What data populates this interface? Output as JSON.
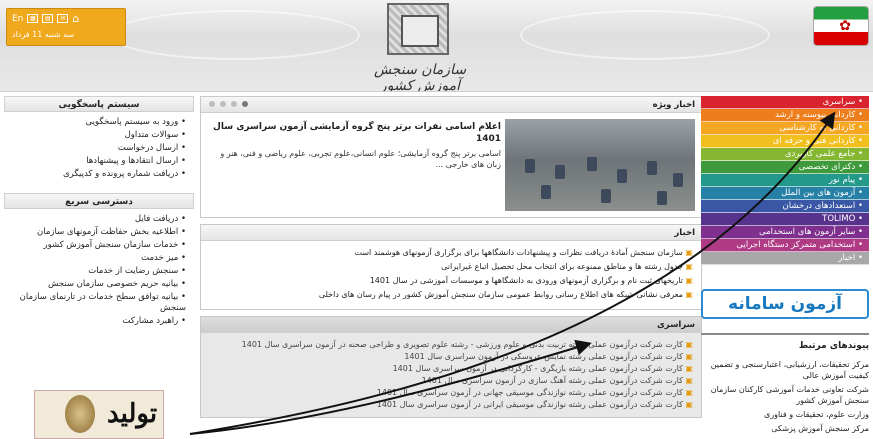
{
  "topbar": {
    "lang": "En",
    "date": "سه شنبه 11 فرداد"
  },
  "header": {
    "org_name": "سازمان سنجش آموزش کشور",
    "icons": [
      "home-icon",
      "mail-icon",
      "document-icon",
      "sitemap-icon"
    ]
  },
  "menu": {
    "items": [
      {
        "label": "سراسری",
        "color": "#d9232e"
      },
      {
        "label": "کاردانی پیوسته و ارشد",
        "color": "#ee7d1c"
      },
      {
        "label": "کاردانی به کارشناسی",
        "color": "#f5a623"
      },
      {
        "label": "کاردانی فنی و حرفه ای",
        "color": "#f2c01e"
      },
      {
        "label": "جامع علمی کاربردی",
        "color": "#86b733"
      },
      {
        "label": "دکترای تخصصی",
        "color": "#3e9a3c"
      },
      {
        "label": "پیام نور",
        "color": "#22998b"
      },
      {
        "label": "آزمون های بین الملل",
        "color": "#2781a6"
      },
      {
        "label": "استعدادهای درخشان",
        "color": "#3957a5"
      },
      {
        "label": "TOLIMO",
        "color": "#58338d"
      },
      {
        "label": "سایر آزمون های استخدامی",
        "color": "#7f2f8d"
      },
      {
        "label": "استخدامی متمرکز دستگاه اجرایی",
        "color": "#b03b85"
      },
      {
        "label": "اخبار",
        "color": "#a8a8a8"
      }
    ]
  },
  "brand": "آزمون سامانه",
  "links": {
    "title": "پیوندهای مرتبط",
    "items": [
      "مرکز تحقیقات، ارزشیابی، اعتبارسنجی و تضمین کیفیت آموزش عالی",
      "شرکت تعاونی خدمات آموزشی کارکنان سازمان سنجش آموزش کشور",
      "وزارت علوم، تحقیقات و فناوری",
      "مرکز سنجش آموزش پزشکی"
    ]
  },
  "featured": {
    "title": "اخبار ویژه",
    "headline": "اعلام اسامی نفرات برتر پنج گروه آزمایشی آزمون سراسری سال 1401",
    "body": "اسامی برتر پنج گروه آزمایشی؛ علوم انسانی،علوم تجربی، علوم ریاضی و فنی، هنر و زبان های خارجی ..."
  },
  "news": {
    "title": "اخبار",
    "items": [
      "سازمان سنجش آمادهٔ دریافت نظرات و پیشنهادات دانشگاهها برای برگزاری آزمونهای هوشمند است",
      "جدول رشته ها و مناطق ممنوعه برای انتخاب محل تحصیل اتباع غیرایرانی",
      "تاریخهای ثبت نام و برگزاری آزمونهای ورودی به دانشگاهها و موسسات آموزشی در سال 1401",
      "معرفی نشانی شبکه های اطلاع رسانی روابط عمومی سازمان سنجش آموزش کشور در پیام رسان های داخلی"
    ]
  },
  "sarasari": {
    "title": "سراسری",
    "items": [
      "کارت شرکت درآزمون عملی رشته تربیت بدنی و علوم ورزشی - رشته علوم تصویری و طراحی صحنه در آزمون سراسری سال 1401",
      "کارت شرکت درآزمون عملی رشته نمایش عروسکی در آزمون سراسری سال 1401",
      "کارت شرکت درآزمون عملی رشته بازیگری - کارگردانی در آزمون سراسری سال 1401",
      "کارت شرکت درآزمون عملی رشته آهنگ سازی در آزمون سراسری سال 1401",
      "کارت شرکت درآزمون عملی رشته نوازندگی موسیقی جهانی در آزمون سراسری سال 1401",
      "کارت شرکت درآزمون عملی رشته نوازندگی موسیقی ایرانی در آزمون سراسری سال 1401"
    ]
  },
  "respond": {
    "title": "سیستم پاسخگویی",
    "items": [
      "ورود به سیستم پاسخگویی",
      "سوالات متداول",
      "ارسال درخواست",
      "ارسال انتقادها و پیشنهادها",
      "دریافت شماره پرونده و کدپیگری"
    ]
  },
  "quick": {
    "title": "دسترسی سریع",
    "items": [
      "دریافت فایل",
      "اطلاعیه بخش حفاظت آزمونهای سازمان",
      "خدمات سازمان سنجش آموزش کشور",
      "میز خدمت",
      "سنجش رضایت از خدمات",
      "بیانیه حریم خصوصی سازمان سنجش",
      "بیانیه توافق سطح خدمات در تارنمای سازمان سنجش",
      "راهبرد مشارکت"
    ]
  },
  "ad": {
    "text": "تولید"
  }
}
